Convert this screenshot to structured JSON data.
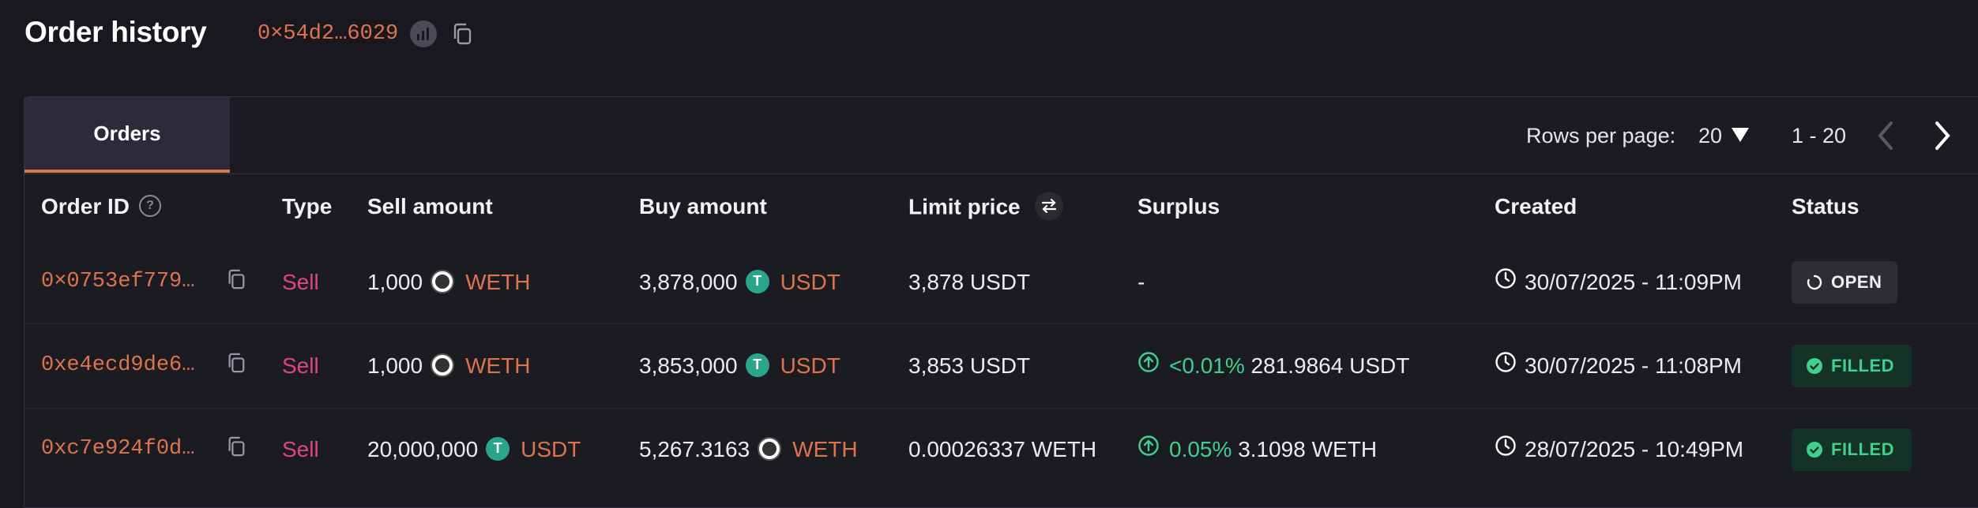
{
  "header": {
    "title": "Order history",
    "address": "0×54d2…6029"
  },
  "tabs": [
    {
      "label": "Orders",
      "active": true
    }
  ],
  "pagination": {
    "rows_per_page_label": "Rows per page:",
    "rows_per_page_value": "20",
    "range": "1 - 20"
  },
  "columns": {
    "order_id": "Order ID",
    "type": "Type",
    "sell_amount": "Sell amount",
    "buy_amount": "Buy amount",
    "limit_price": "Limit price",
    "surplus": "Surplus",
    "created": "Created",
    "status": "Status"
  },
  "rows": [
    {
      "order_id": "0×0753ef779…",
      "type": "Sell",
      "sell_value": "1,000",
      "sell_token": "WETH",
      "buy_value": "3,878,000",
      "buy_token": "USDT",
      "limit_price": "3,878 USDT",
      "surplus_pct": "",
      "surplus_value": "-",
      "created": "30/07/2025 - 11:09PM",
      "status": "OPEN"
    },
    {
      "order_id": "0xe4ecd9de6…",
      "type": "Sell",
      "sell_value": "1,000",
      "sell_token": "WETH",
      "buy_value": "3,853,000",
      "buy_token": "USDT",
      "limit_price": "3,853 USDT",
      "surplus_pct": "<0.01%",
      "surplus_value": "281.9864 USDT",
      "created": "30/07/2025 - 11:08PM",
      "status": "FILLED"
    },
    {
      "order_id": "0xc7e924f0d…",
      "type": "Sell",
      "sell_value": "20,000,000",
      "sell_token": "USDT",
      "buy_value": "5,267.3163",
      "buy_token": "WETH",
      "limit_price": "0.00026337 WETH",
      "surplus_pct": "0.05%",
      "surplus_value": "3.1098 WETH",
      "created": "28/07/2025 - 10:49PM",
      "status": "FILLED"
    }
  ],
  "colors": {
    "accent": "#e0734f",
    "sell": "#e0467c",
    "success": "#3fcf8e",
    "background": "#18181e"
  }
}
